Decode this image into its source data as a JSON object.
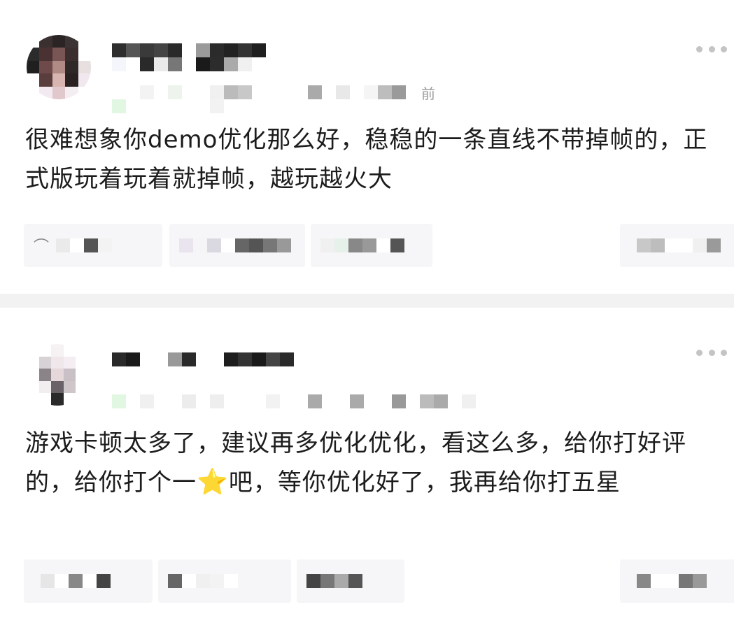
{
  "comments": [
    {
      "time_suffix": "前",
      "text": "很难想象你demo优化那么好，稳稳的一条直线不带掉帧的，正式版玩着玩着就掉帧，越玩越火大"
    },
    {
      "text_before_emoji": "游戏卡顿太多了，建议再多优化优化，看这么多，给你打好评的，给你打个一",
      "emoji": "⭐",
      "text_after_emoji": "吧，等你优化好了，我再给你打五星"
    }
  ],
  "icons": {
    "more": "more-dots-icon",
    "star": "star-emoji-icon",
    "comment": "comment-icon",
    "like": "like-icon"
  },
  "colors": {
    "background": "#ffffff",
    "separator": "#f2f2f2",
    "text": "#1c1c1c",
    "muted": "#9a9a9a",
    "action_bg": "#f6f6f8"
  }
}
